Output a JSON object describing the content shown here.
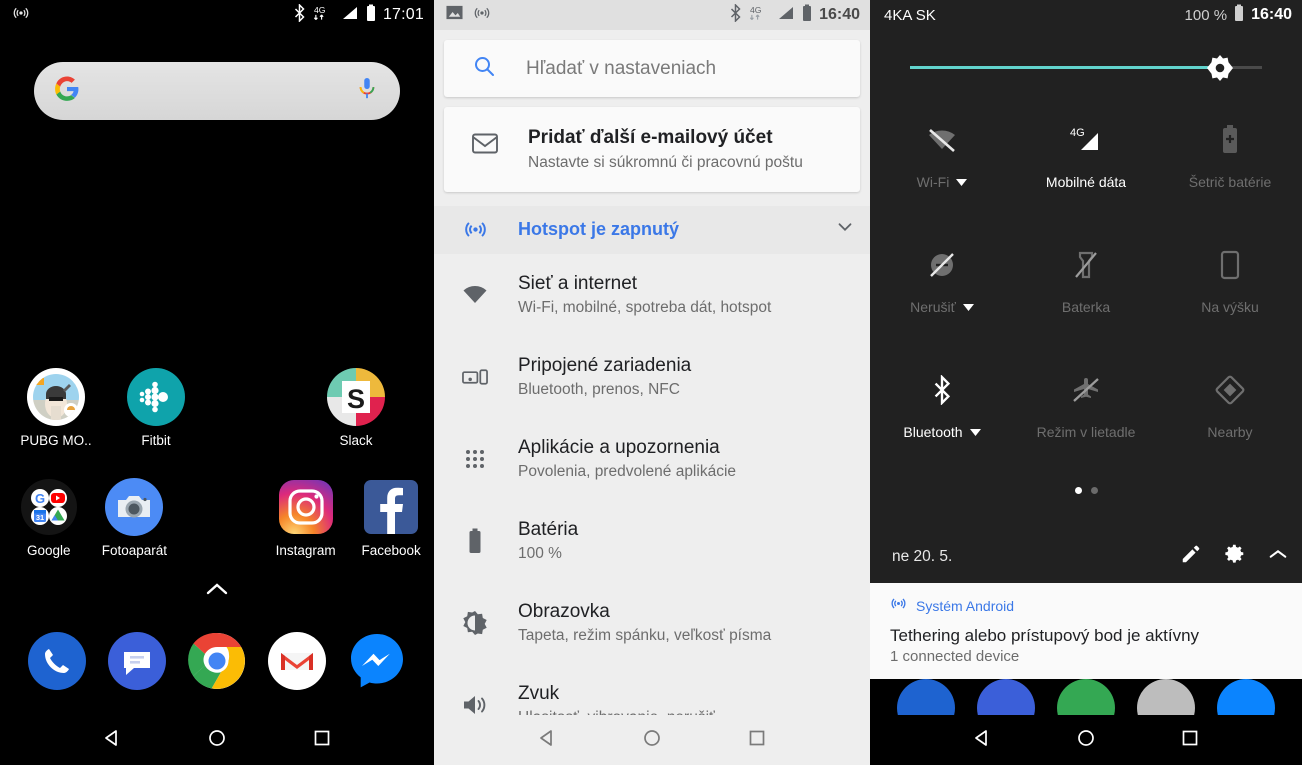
{
  "home": {
    "statusbar": {
      "hotspot_icon": "hotspot-icon",
      "bluetooth_icon": "bluetooth-icon",
      "data_icon": "4g-data-icon",
      "signal_icon": "signal-icon",
      "battery_icon": "battery-icon",
      "clock": "17:01"
    },
    "search": {
      "google_icon": "google-g-icon",
      "mic_icon": "microphone-icon"
    },
    "page_arrow_icon": "chevron-up-icon",
    "apps_row1": [
      {
        "label": "PUBG MO..",
        "icon": "pubg-mobile-icon"
      },
      {
        "label": "Fitbit",
        "icon": "fitbit-icon"
      },
      {
        "label": "",
        "icon": "empty-slot"
      },
      {
        "label": "Slack",
        "icon": "slack-icon"
      }
    ],
    "apps_row2": [
      {
        "label": "Google",
        "icon": "google-folder-icon"
      },
      {
        "label": "Fotoaparát",
        "icon": "camera-icon"
      },
      {
        "label": "",
        "icon": "empty-slot"
      },
      {
        "label": "Instagram",
        "icon": "instagram-icon"
      },
      {
        "label": "Facebook",
        "icon": "facebook-icon"
      }
    ],
    "dock": [
      {
        "label": "Phone",
        "icon": "phone-icon"
      },
      {
        "label": "Messages",
        "icon": "messages-icon"
      },
      {
        "label": "Chrome",
        "icon": "chrome-icon"
      },
      {
        "label": "Gmail",
        "icon": "gmail-icon"
      },
      {
        "label": "Messenger",
        "icon": "messenger-icon"
      }
    ],
    "navbar": {
      "back_icon": "back-triangle-icon",
      "home_icon": "home-circle-icon",
      "recents_icon": "recents-square-icon"
    }
  },
  "settings": {
    "statusbar": {
      "image_icon": "image-icon",
      "hotspot_icon": "hotspot-icon",
      "bluetooth_icon": "bluetooth-icon",
      "data_icon": "4g-data-icon",
      "signal_icon": "signal-icon",
      "battery_icon": "battery-icon",
      "clock": "16:40"
    },
    "search": {
      "placeholder": "Hľadať v nastaveniach",
      "icon": "search-icon"
    },
    "email_card": {
      "icon": "gmail-envelope-icon",
      "title": "Pridať ďalší e-mailový účet",
      "subtitle": "Nastavte si súkromnú či pracovnú poštu"
    },
    "hotspot_row": {
      "icon": "hotspot-icon",
      "label": "Hotspot je zapnutý",
      "chevron_icon": "chevron-down-icon",
      "accent": "#3b78e7"
    },
    "rows": [
      {
        "icon": "wifi-icon",
        "title": "Sieť a internet",
        "subtitle": "Wi-Fi, mobilné, spotreba dát, hotspot"
      },
      {
        "icon": "connected-devices-icon",
        "title": "Pripojené zariadenia",
        "subtitle": "Bluetooth, prenos, NFC"
      },
      {
        "icon": "apps-grid-icon",
        "title": "Aplikácie a upozornenia",
        "subtitle": "Povolenia, predvolené aplikácie"
      },
      {
        "icon": "battery-icon",
        "title": "Batéria",
        "subtitle": "100 %"
      },
      {
        "icon": "display-brightness-icon",
        "title": "Obrazovka",
        "subtitle": "Tapeta, režim spánku, veľkosť písma"
      },
      {
        "icon": "sound-icon",
        "title": "Zvuk",
        "subtitle": "Hlasitosť, vibrovanie, nerušiť"
      }
    ],
    "navbar": {
      "back_icon": "back-triangle-icon",
      "home_icon": "home-circle-icon",
      "recents_icon": "recents-square-icon"
    }
  },
  "quicksettings": {
    "statusbar": {
      "carrier": "4KA SK",
      "battery_pct": "100 %",
      "battery_icon": "battery-icon",
      "clock": "16:40"
    },
    "brightness": {
      "value_pct": 88,
      "knob_icon": "brightness-knob-icon",
      "fill_color": "#62d4cd"
    },
    "tiles_row1": [
      {
        "label": "Wi-Fi",
        "icon": "wifi-off-icon",
        "state": "off",
        "has_caret": true
      },
      {
        "label": "Mobilné dáta",
        "icon": "4g-signal-icon",
        "state": "on",
        "has_caret": false
      },
      {
        "label": "Šetrič batérie",
        "icon": "battery-saver-icon",
        "state": "disabled",
        "has_caret": false
      }
    ],
    "tiles_row2": [
      {
        "label": "Nerušiť",
        "icon": "do-not-disturb-icon",
        "state": "off",
        "has_caret": true
      },
      {
        "label": "Baterka",
        "icon": "flashlight-off-icon",
        "state": "off",
        "has_caret": false
      },
      {
        "label": "Na výšku",
        "icon": "portrait-rotation-icon",
        "state": "off",
        "has_caret": false
      }
    ],
    "tiles_row3": [
      {
        "label": "Bluetooth",
        "icon": "bluetooth-icon",
        "state": "on",
        "has_caret": true
      },
      {
        "label": "Režim v lietadle",
        "icon": "airplane-off-icon",
        "state": "off",
        "has_caret": false
      },
      {
        "label": "Nearby",
        "icon": "nearby-icon",
        "state": "off",
        "has_caret": false
      }
    ],
    "pager": {
      "pages": 2,
      "active": 0
    },
    "footer": {
      "date": "ne 20. 5.",
      "edit_icon": "edit-pencil-icon",
      "settings_icon": "gear-icon",
      "collapse_icon": "chevron-up-icon"
    },
    "notification": {
      "app_icon": "hotspot-icon",
      "app_name": "Systém Android",
      "title": "Tethering alebo prístupový bod je aktívny",
      "subtitle": "1 connected device"
    },
    "navbar": {
      "back_icon": "back-triangle-icon",
      "home_icon": "home-circle-icon",
      "recents_icon": "recents-square-icon"
    }
  }
}
